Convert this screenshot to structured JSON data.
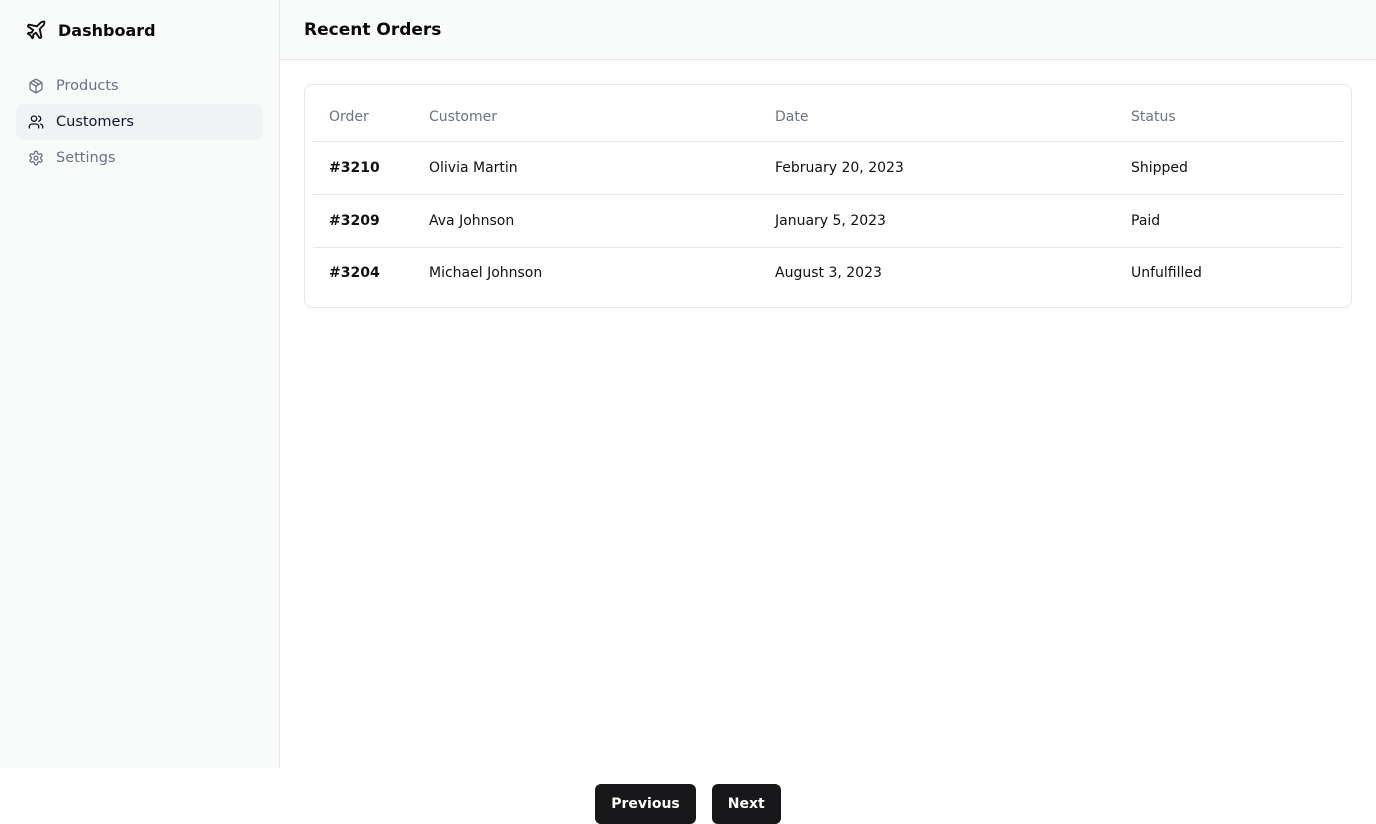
{
  "sidebar": {
    "brand": {
      "title": "Dashboard",
      "icon": "plane-icon"
    },
    "items": [
      {
        "label": "Products",
        "icon": "package-icon",
        "active": false
      },
      {
        "label": "Customers",
        "icon": "users-icon",
        "active": true
      },
      {
        "label": "Settings",
        "icon": "gear-icon",
        "active": false
      }
    ]
  },
  "header": {
    "title": "Recent Orders"
  },
  "table": {
    "columns": [
      "Order",
      "Customer",
      "Date",
      "Status"
    ],
    "rows": [
      {
        "order": "#3210",
        "customer": "Olivia Martin",
        "date": "February 20, 2023",
        "status": "Shipped"
      },
      {
        "order": "#3209",
        "customer": "Ava Johnson",
        "date": "January 5, 2023",
        "status": "Paid"
      },
      {
        "order": "#3204",
        "customer": "Michael Johnson",
        "date": "August 3, 2023",
        "status": "Unfulfilled"
      }
    ]
  },
  "pagination": {
    "previous_label": "Previous",
    "next_label": "Next"
  },
  "colors": {
    "accent": "#18181b",
    "sidebar_bg": "#f9fafa",
    "active_item_bg": "#f1f2f4",
    "muted_text": "#6b7280"
  }
}
